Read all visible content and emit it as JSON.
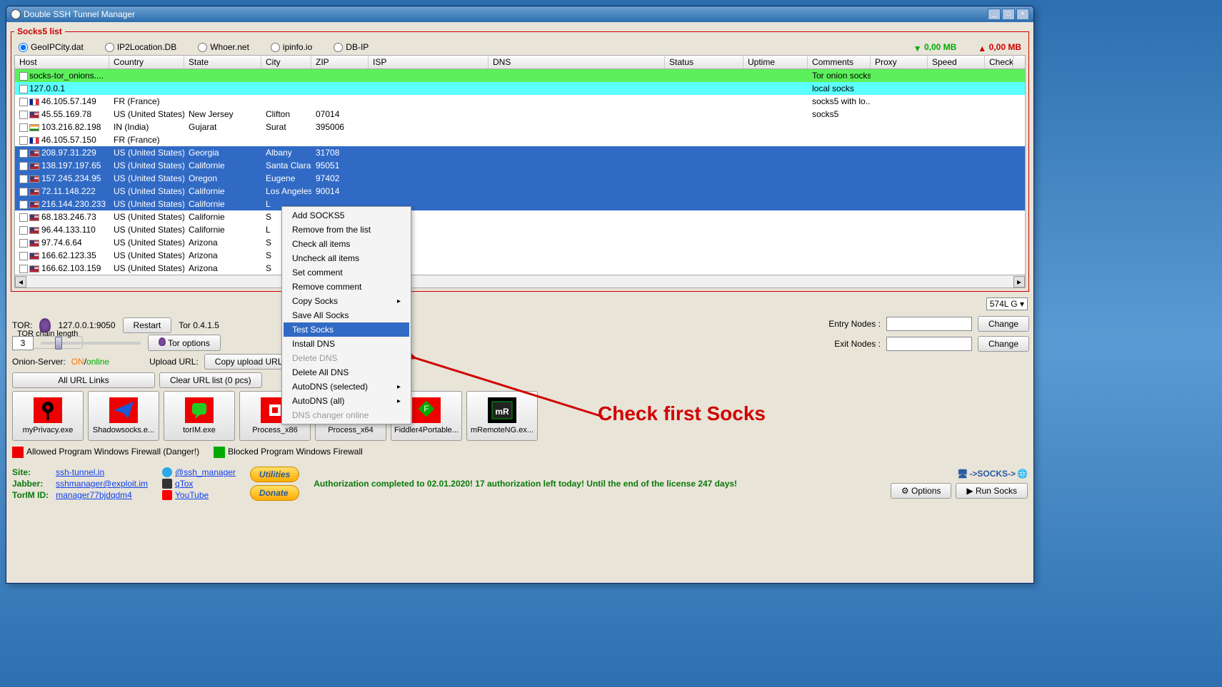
{
  "titlebar": {
    "title": "Double SSH Tunnel Manager"
  },
  "socks_legend": "Socks5 list",
  "geo_radios": [
    {
      "label": "GeoIPCity.dat",
      "checked": true
    },
    {
      "label": "IP2Location.DB",
      "checked": false
    },
    {
      "label": "Whoer.net",
      "checked": false
    },
    {
      "label": "ipinfo.io",
      "checked": false
    },
    {
      "label": "DB-IP",
      "checked": false
    }
  ],
  "net_down": "0,00 MB",
  "net_up": "0,00 MB",
  "columns": [
    "Host",
    "Country",
    "State",
    "City",
    "ZIP",
    "ISP",
    "DNS",
    "Status",
    "Uptime",
    "Comments",
    "Proxy",
    "Speed",
    "Check"
  ],
  "rows": [
    {
      "style": "green",
      "host": "socks-tor_onions....",
      "country": "",
      "state": "",
      "city": "",
      "zip": "",
      "isp": "",
      "dns": "",
      "status": "",
      "uptime": "",
      "comments": "Tor onion socks",
      "flag": ""
    },
    {
      "style": "cyan",
      "host": "127.0.0.1",
      "country": "",
      "state": "",
      "city": "",
      "zip": "",
      "isp": "",
      "dns": "",
      "status": "",
      "uptime": "",
      "comments": "local socks",
      "flag": ""
    },
    {
      "style": "",
      "host": "46.105.57.149",
      "country": "FR (France)",
      "state": "",
      "city": "",
      "zip": "",
      "isp": "",
      "dns": "",
      "status": "",
      "uptime": "",
      "comments": "socks5 with lo...",
      "flag": "fr"
    },
    {
      "style": "",
      "host": "45.55.169.78",
      "country": "US (United States)",
      "state": "New Jersey",
      "city": "Clifton",
      "zip": "07014",
      "isp": "",
      "dns": "",
      "status": "",
      "uptime": "",
      "comments": "socks5",
      "flag": "us"
    },
    {
      "style": "",
      "host": "103.216.82.198",
      "country": "IN (India)",
      "state": "Gujarat",
      "city": "Surat",
      "zip": "395006",
      "isp": "",
      "dns": "",
      "status": "",
      "uptime": "",
      "comments": "",
      "flag": "in"
    },
    {
      "style": "",
      "host": "46.105.57.150",
      "country": "FR (France)",
      "state": "",
      "city": "",
      "zip": "",
      "isp": "",
      "dns": "",
      "status": "",
      "uptime": "",
      "comments": "",
      "flag": "fr"
    },
    {
      "style": "sel",
      "host": "208.97.31.229",
      "country": "US (United States)",
      "state": "Georgia",
      "city": "Albany",
      "zip": "31708",
      "isp": "",
      "dns": "",
      "status": "",
      "uptime": "",
      "comments": "",
      "flag": "us"
    },
    {
      "style": "sel",
      "host": "138.197.197.65",
      "country": "US (United States)",
      "state": "Californie",
      "city": "Santa Clara",
      "zip": "95051",
      "isp": "",
      "dns": "",
      "status": "",
      "uptime": "",
      "comments": "",
      "flag": "us"
    },
    {
      "style": "sel",
      "host": "157.245.234.95",
      "country": "US (United States)",
      "state": "Oregon",
      "city": "Eugene",
      "zip": "97402",
      "isp": "",
      "dns": "",
      "status": "",
      "uptime": "",
      "comments": "",
      "flag": "us"
    },
    {
      "style": "sel",
      "host": "72.11.148.222",
      "country": "US (United States)",
      "state": "Californie",
      "city": "Los Angeles",
      "zip": "90014",
      "isp": "",
      "dns": "",
      "status": "",
      "uptime": "",
      "comments": "",
      "flag": "us"
    },
    {
      "style": "sel",
      "host": "216.144.230.233",
      "country": "US (United States)",
      "state": "Californie",
      "city": "L",
      "zip": "",
      "isp": "",
      "dns": "",
      "status": "",
      "uptime": "",
      "comments": "",
      "flag": "us"
    },
    {
      "style": "",
      "host": "68.183.246.73",
      "country": "US (United States)",
      "state": "Californie",
      "city": "S",
      "zip": "",
      "isp": "",
      "dns": "",
      "status": "",
      "uptime": "",
      "comments": "",
      "flag": "us"
    },
    {
      "style": "",
      "host": "96.44.133.110",
      "country": "US (United States)",
      "state": "Californie",
      "city": "L",
      "zip": "",
      "isp": "",
      "dns": "",
      "status": "",
      "uptime": "",
      "comments": "",
      "flag": "us"
    },
    {
      "style": "",
      "host": "97.74.6.64",
      "country": "US (United States)",
      "state": "Arizona",
      "city": "S",
      "zip": "",
      "isp": "",
      "dns": "",
      "status": "",
      "uptime": "",
      "comments": "",
      "flag": "us"
    },
    {
      "style": "",
      "host": "166.62.123.35",
      "country": "US (United States)",
      "state": "Arizona",
      "city": "S",
      "zip": "",
      "isp": "",
      "dns": "",
      "status": "",
      "uptime": "",
      "comments": "",
      "flag": "us"
    },
    {
      "style": "",
      "host": "166.62.103.159",
      "country": "US (United States)",
      "state": "Arizona",
      "city": "S",
      "zip": "",
      "isp": "",
      "dns": "",
      "status": "",
      "uptime": "",
      "comments": "",
      "flag": "us"
    }
  ],
  "nic_select_visible": "574L G",
  "tor": {
    "label": "TOR:",
    "address": "127.0.0.1:9050",
    "restart_btn": "Restart",
    "version": "Tor 0.4.1.5",
    "chain_label": "TOR chain length",
    "chain_value": "3",
    "tor_options_btn": "Tor options",
    "entry_label": "Entry Nodes :",
    "exit_label": "Exit Nodes :",
    "change_btn": "Change"
  },
  "onion": {
    "label": "Onion-Server:",
    "on": "ON",
    "slash": "/",
    "online": "online",
    "upload_label": "Upload URL:",
    "copy_url_btn": "Copy upload URL"
  },
  "url_buttons": {
    "all": "All URL Links",
    "clear": "Clear URL list (0 pcs)"
  },
  "launchers": [
    {
      "label": "myPrivacy.exe",
      "color": "#e00",
      "icon": "pin"
    },
    {
      "label": "Shadowsocks.e...",
      "color": "#e00",
      "icon": "plane"
    },
    {
      "label": "torIM.exe",
      "color": "#e00",
      "icon": "chat"
    },
    {
      "label": "Process_x86",
      "color": "#e00",
      "icon": "proc"
    },
    {
      "label": "Process_x64",
      "color": "#e00",
      "icon": "proc"
    },
    {
      "label": "Fiddler4Portable...",
      "color": "#e00",
      "icon": "fiddle"
    },
    {
      "label": "mRemoteNG.ex...",
      "color": "#000",
      "icon": "mr"
    }
  ],
  "firewall": {
    "allowed": "Allowed Program Windows Firewall (Danger!)",
    "blocked": "Blocked Program Windows Firewall"
  },
  "footer": {
    "site_k": "Site:",
    "site_v": "ssh-tunnel.in",
    "jabber_k": "Jabber:",
    "jabber_v": "sshmanager@exploit.im",
    "torim_k": "TorIM ID:",
    "torim_v": "manager77bjdqdm4",
    "tg": "@ssh_manager",
    "qtox": "qTox",
    "yt": "YouTube",
    "utilities": "Utilities",
    "donate": "Donate",
    "auth": "Authorization completed to 02.01.2020! 17 authorization left today! Until the end of the license 247 days!",
    "socks_chain": "->SOCKS->",
    "options_btn": "Options",
    "run_btn": "Run Socks"
  },
  "context_menu": [
    {
      "label": "Add SOCKS5",
      "enabled": true,
      "sub": false
    },
    {
      "label": "Remove from the list",
      "enabled": true,
      "sub": false
    },
    {
      "label": "Check all items",
      "enabled": true,
      "sub": false
    },
    {
      "label": "Uncheck all items",
      "enabled": true,
      "sub": false
    },
    {
      "label": "Set comment",
      "enabled": true,
      "sub": false
    },
    {
      "label": "Remove comment",
      "enabled": true,
      "sub": false
    },
    {
      "label": "Copy Socks",
      "enabled": true,
      "sub": true
    },
    {
      "label": "Save All Socks",
      "enabled": true,
      "sub": false
    },
    {
      "label": "Test Socks",
      "enabled": true,
      "sub": false,
      "hl": true
    },
    {
      "label": "Install DNS",
      "enabled": true,
      "sub": false
    },
    {
      "label": "Delete DNS",
      "enabled": false,
      "sub": false
    },
    {
      "label": "Delete All DNS",
      "enabled": true,
      "sub": false
    },
    {
      "label": "AutoDNS (selected)",
      "enabled": true,
      "sub": true
    },
    {
      "label": "AutoDNS (all)",
      "enabled": true,
      "sub": true
    },
    {
      "label": "DNS changer online",
      "enabled": false,
      "sub": false
    }
  ],
  "annotation": "Check first Socks"
}
